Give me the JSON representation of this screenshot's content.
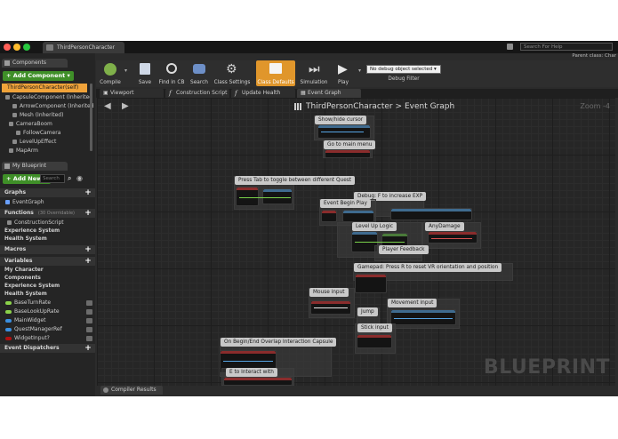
{
  "window": {
    "tab_title": "ThirdPersonCharacter",
    "help_placeholder": "Search For Help",
    "parent_class": "Parent class: Char"
  },
  "components": {
    "tab": "Components",
    "add_button": "+ Add Component ▾",
    "items": [
      "ThirdPersonCharacter(self)",
      "CapsuleComponent (Inherited",
      "ArrowComponent (Inherited",
      "Mesh (Inherited)",
      "CameraBoom",
      "FollowCamera",
      "LevelUpEffect",
      "MapArm"
    ]
  },
  "my_blueprint": {
    "tab": "My Blueprint",
    "add_new": "+ Add New ▾",
    "search_placeholder": "Search",
    "graphs_header": "Graphs",
    "event_graph": "EventGraph",
    "functions_header": "Functions",
    "functions_count": "(30 Overridable)",
    "function_item": "ConstructionScript",
    "function_categories": [
      "Experience System",
      "Health System"
    ],
    "macros_header": "Macros",
    "variables_header": "Variables",
    "variable_categories": [
      "My Character",
      "Components",
      "Experience System",
      "Health System"
    ],
    "variables": [
      {
        "name": "BaseTurnRate",
        "color": "#8bd24a"
      },
      {
        "name": "BaseLookUpRate",
        "color": "#8bd24a"
      },
      {
        "name": "MainWidget",
        "color": "#3a8fe0"
      },
      {
        "name": "QuestManagerRef",
        "color": "#3a8fe0"
      },
      {
        "name": "WidgetInput?",
        "color": "#b01010"
      }
    ],
    "event_dispatchers_header": "Event Dispatchers"
  },
  "toolbar": {
    "buttons": [
      "Compile",
      "Save",
      "Find in CB",
      "Search",
      "Class Settings",
      "Class Defaults",
      "Simulation",
      "Play"
    ],
    "debug_object": "No debug object selected ▾",
    "debug_filter": "Debug Filter"
  },
  "editor_tabs": [
    "Viewport",
    "Construction Script",
    "Update Health",
    "Event Graph"
  ],
  "graph": {
    "breadcrumb_root": "ThirdPersonCharacter",
    "breadcrumb_sep": ">",
    "breadcrumb_current": "Event Graph",
    "zoom": "Zoom -4",
    "watermark": "BLUEPRINT",
    "comments": [
      "Show/hide cursor",
      "Go to main menu",
      "Press Tab to toggle between different Quest",
      "Debug: F to increase EXP",
      "Event Begin Play",
      "Level Up Logic",
      "AnyDamage",
      "Player Feedback",
      "Gamepad: Press R to reset VR orientation and position",
      "Mouse input",
      "Movement input",
      "Jump",
      "Stick input",
      "On Begin/End Overlap Interaction Capsule",
      "E to Interact with"
    ]
  },
  "bottom": {
    "compiler_results": "Compiler Results"
  }
}
